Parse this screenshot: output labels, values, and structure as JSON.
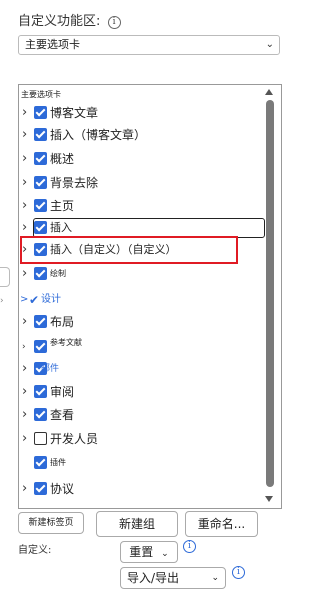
{
  "header": {
    "title": "自定义功能区:",
    "info": "i"
  },
  "dropdown": {
    "value": "主要选项卡"
  },
  "list": {
    "header": "主要选项卡",
    "items": [
      {
        "label": "博客文章",
        "state": "checked",
        "expander": true
      },
      {
        "label": "插入（博客文章）",
        "state": "checked",
        "expander": true
      },
      {
        "label": "概述",
        "state": "checked",
        "expander": true
      },
      {
        "label": "背景去除",
        "state": "checked",
        "expander": true
      },
      {
        "label": "主页",
        "state": "checked",
        "expander": true
      },
      {
        "label": "插入",
        "state": "checked",
        "expander": true,
        "focused": true
      },
      {
        "label": "插入（自定义）（自定义）",
        "state": "checked",
        "expander": true,
        "highlighted": true
      },
      {
        "label": "绘制",
        "state": "checked",
        "expander": true
      },
      {
        "label": "设计",
        "state": "checked-blue",
        "expander": true
      },
      {
        "label": "布局",
        "state": "checked",
        "expander": true
      },
      {
        "label": "参考文献",
        "state": "checked",
        "expander": true
      },
      {
        "label": "邮件",
        "state": "checked",
        "expander": true
      },
      {
        "label": "审阅",
        "state": "checked",
        "expander": true
      },
      {
        "label": "查看",
        "state": "checked",
        "expander": true
      },
      {
        "label": "开发人员",
        "state": "unchecked",
        "expander": true
      },
      {
        "label": "插件",
        "state": "checked",
        "expander": false
      },
      {
        "label": "协议",
        "state": "checked",
        "expander": true
      }
    ]
  },
  "buttons": {
    "new_tab": "新建标签页",
    "new_group": "新建组",
    "rename": "重命名..."
  },
  "customize": {
    "label": "自定义:",
    "reset": "重置",
    "import_export": "导入/导出",
    "info": "i"
  },
  "colors": {
    "accent": "#2d6ad8",
    "highlight": "#e01b24"
  }
}
